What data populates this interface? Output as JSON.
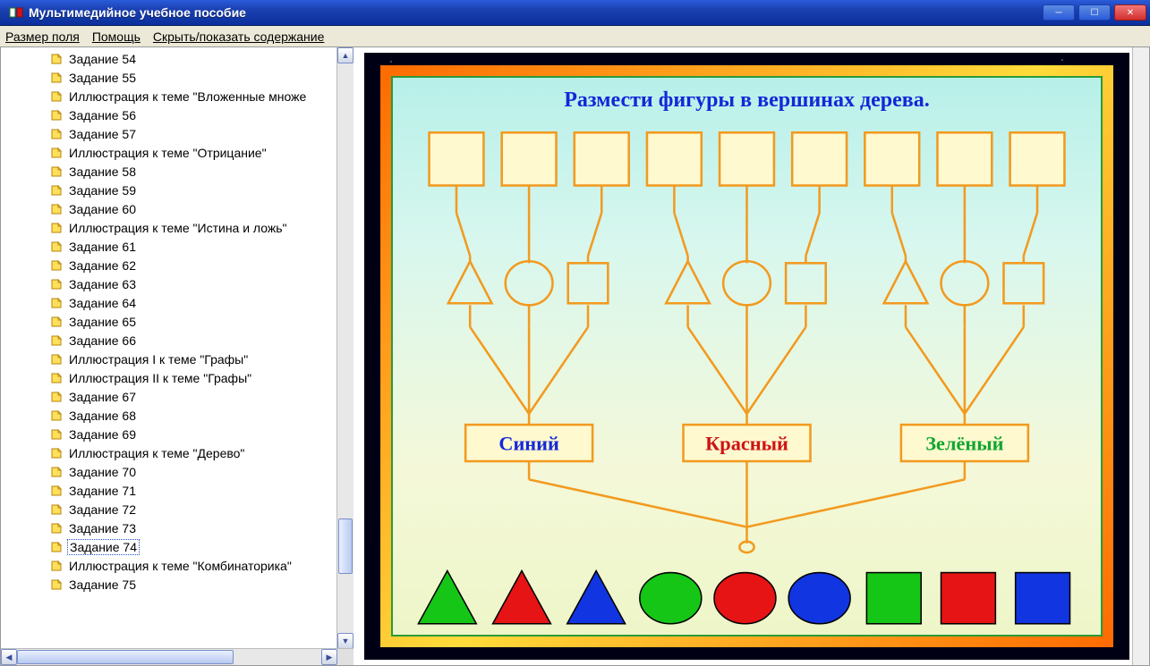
{
  "window": {
    "title": "Мультимедийное учебное пособие"
  },
  "menu": {
    "field_size": "Размер поля",
    "help": "Помощь",
    "toggle_toc": "Скрыть/показать содержание"
  },
  "sidebar": {
    "items": [
      "Задание 54",
      "Задание 55",
      "Иллюстрация к теме \"Вложенные множе",
      "Задание 56",
      "Задание 57",
      "Иллюстрация к теме \"Отрицание\"",
      "Задание 58",
      "Задание 59",
      "Задание 60",
      "Иллюстрация к теме \"Истина и ложь\"",
      "Задание 61",
      "Задание 62",
      "Задание 63",
      "Задание 64",
      "Задание 65",
      "Задание 66",
      "Иллюстрация I к теме \"Графы\"",
      "Иллюстрация II к теме \"Графы\"",
      "Задание 67",
      "Задание 68",
      "Задание 69",
      "Иллюстрация к теме \"Дерево\"",
      "Задание 70",
      "Задание 71",
      "Задание 72",
      "Задание 73",
      "Задание 74",
      "Иллюстрация к теме \"Комбинаторика\"",
      "Задание 75"
    ],
    "selected_index": 26
  },
  "stage": {
    "title": "Размести фигуры в вершинах дерева.",
    "labels": {
      "blue": "Синий",
      "red": "Красный",
      "green": "Зелёный"
    },
    "top_slot_count": 9,
    "shape_labels": [
      "triangle",
      "circle",
      "square"
    ],
    "palette_shapes": [
      {
        "shape": "triangle",
        "color": "#16c616"
      },
      {
        "shape": "triangle",
        "color": "#e61414"
      },
      {
        "shape": "triangle",
        "color": "#1135e0"
      },
      {
        "shape": "circle",
        "color": "#16c616"
      },
      {
        "shape": "circle",
        "color": "#e61414"
      },
      {
        "shape": "circle",
        "color": "#1135e0"
      },
      {
        "shape": "square",
        "color": "#16c616"
      },
      {
        "shape": "square",
        "color": "#e61414"
      },
      {
        "shape": "square",
        "color": "#1135e0"
      }
    ]
  }
}
